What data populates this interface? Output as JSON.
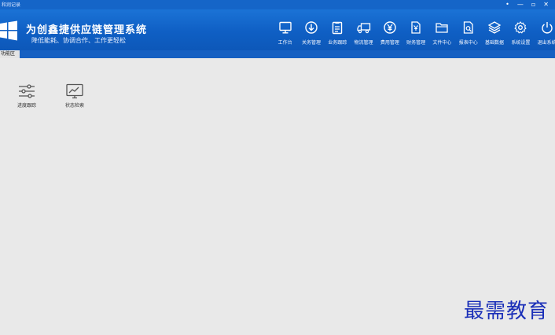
{
  "window": {
    "title": "和润记录",
    "controls": [
      "•",
      "—",
      "▫",
      "✕"
    ]
  },
  "header": {
    "title": "为创鑫捷供应链管理系统",
    "subtitle": "降低能耗、协调合作、工作更轻松",
    "nav": [
      {
        "label": "工作台",
        "icon": "monitor-icon"
      },
      {
        "label": "关务管理",
        "icon": "download-circle-icon"
      },
      {
        "label": "业务跟踪",
        "icon": "clipboard-icon"
      },
      {
        "label": "物流管理",
        "icon": "truck-icon"
      },
      {
        "label": "费用管理",
        "icon": "yen-icon"
      },
      {
        "label": "财务管理",
        "icon": "finance-doc-icon"
      },
      {
        "label": "文件中心",
        "icon": "folder-icon"
      },
      {
        "label": "报表中心",
        "icon": "report-search-icon"
      },
      {
        "label": "基础数据",
        "icon": "layers-icon"
      },
      {
        "label": "系统设置",
        "icon": "gear-icon"
      },
      {
        "label": "退出系统",
        "icon": "power-icon"
      }
    ]
  },
  "tabs": [
    {
      "label": "功能区"
    }
  ],
  "tiles": [
    {
      "label": "进度跟踪",
      "icon": "sliders-icon"
    },
    {
      "label": "状态检索",
      "icon": "chart-monitor-icon"
    }
  ],
  "watermark": "最需教育"
}
